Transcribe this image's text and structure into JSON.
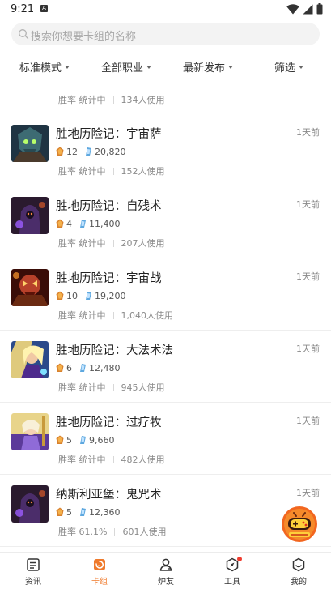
{
  "status_bar": {
    "time": "9:21",
    "notification_letter": "A"
  },
  "search": {
    "placeholder": "搜索你想要卡组的名称"
  },
  "filters": [
    {
      "label": "标准模式"
    },
    {
      "label": "全部职业"
    },
    {
      "label": "最新发布"
    },
    {
      "label": "筛选"
    }
  ],
  "colors": {
    "accent": "#ef7a2c",
    "badge": "#f03c2f",
    "dust": "#5ea8df"
  },
  "decks": [
    {
      "name": "",
      "time": "",
      "win_label": "胜率 统计中",
      "usage": "134人使用",
      "icon": "hero-portrait-icon"
    },
    {
      "name": "胜地历险记：宇宙萨",
      "time": "1天前",
      "cost": "12",
      "dust": "20,820",
      "win_label": "胜率 统计中",
      "usage": "152人使用",
      "icon": "shaman-portrait-icon"
    },
    {
      "name": "胜地历险记：自残术",
      "time": "1天前",
      "cost": "4",
      "dust": "11,400",
      "win_label": "胜率 统计中",
      "usage": "207人使用",
      "icon": "warlock-portrait-icon"
    },
    {
      "name": "胜地历险记：宇宙战",
      "time": "1天前",
      "cost": "10",
      "dust": "19,200",
      "win_label": "胜率 统计中",
      "usage": "1,040人使用",
      "icon": "warrior-portrait-icon"
    },
    {
      "name": "胜地历险记：大法术法",
      "time": "1天前",
      "cost": "6",
      "dust": "12,480",
      "win_label": "胜率 统计中",
      "usage": "945人使用",
      "icon": "mage-portrait-icon"
    },
    {
      "name": "胜地历险记：过疗牧",
      "time": "1天前",
      "cost": "5",
      "dust": "9,660",
      "win_label": "胜率 统计中",
      "usage": "482人使用",
      "icon": "priest-portrait-icon"
    },
    {
      "name": "纳斯利亚堡：鬼咒术",
      "time": "1天前",
      "cost": "5",
      "dust": "12,360",
      "win_label": "胜率 61.1%",
      "usage": "601人使用",
      "icon": "warlock-portrait-icon"
    }
  ],
  "tabs": [
    {
      "label": "资讯",
      "icon": "news-icon"
    },
    {
      "label": "卡组",
      "icon": "deck-icon",
      "active": true
    },
    {
      "label": "炉友",
      "icon": "friends-icon"
    },
    {
      "label": "工具",
      "icon": "compass-tool-icon",
      "badge": true
    },
    {
      "label": "我的",
      "icon": "profile-icon"
    }
  ]
}
